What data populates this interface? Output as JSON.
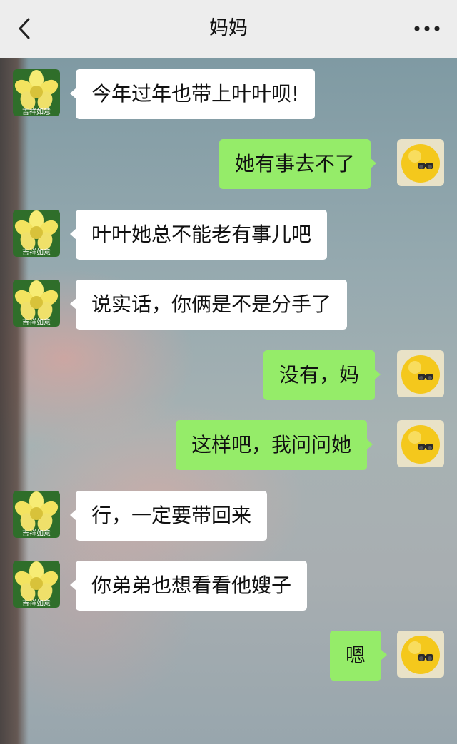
{
  "header": {
    "title": "妈妈",
    "back_icon": "chevron-left-icon",
    "more_icon": "more-dots-icon"
  },
  "avatars": {
    "mom": {
      "caption": "吉祥如意",
      "icon": "yellow-flower-icon"
    },
    "me": {
      "icon": "yellow-chick-binoculars-icon"
    }
  },
  "colors": {
    "header_bg": "#ededed",
    "incoming_bubble": "#ffffff",
    "outgoing_bubble": "#95ec69"
  },
  "messages": [
    {
      "sender": "mom",
      "text": "今年过年也带上叶叶呗!"
    },
    {
      "sender": "me",
      "text": "她有事去不了"
    },
    {
      "sender": "mom",
      "text": "叶叶她总不能老有事儿吧"
    },
    {
      "sender": "mom",
      "text": "说实话，你俩是不是分手了"
    },
    {
      "sender": "me",
      "text": "没有，妈"
    },
    {
      "sender": "me",
      "text": "这样吧，我问问她"
    },
    {
      "sender": "mom",
      "text": "行，一定要带回来"
    },
    {
      "sender": "mom",
      "text": "你弟弟也想看看他嫂子"
    },
    {
      "sender": "me",
      "text": "嗯"
    }
  ]
}
